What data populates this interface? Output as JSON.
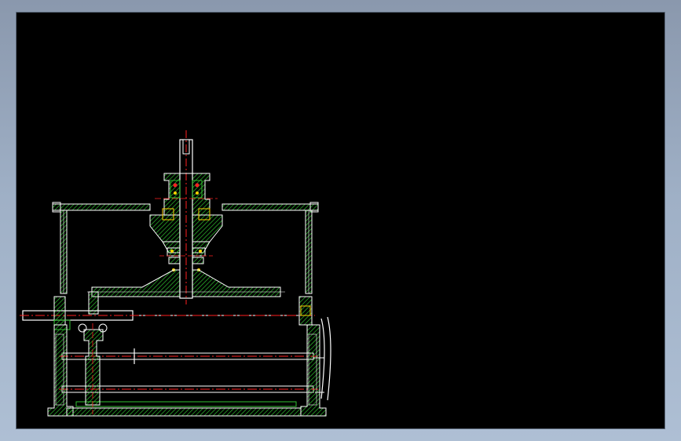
{
  "window": {
    "background": "#000000",
    "frame_color": "#9fb0c6"
  },
  "drawing": {
    "colors": {
      "outline": "#ffffff",
      "hatch": "#2fbf2f",
      "centerline": "#ff2020",
      "accent": "#ffd400"
    }
  }
}
